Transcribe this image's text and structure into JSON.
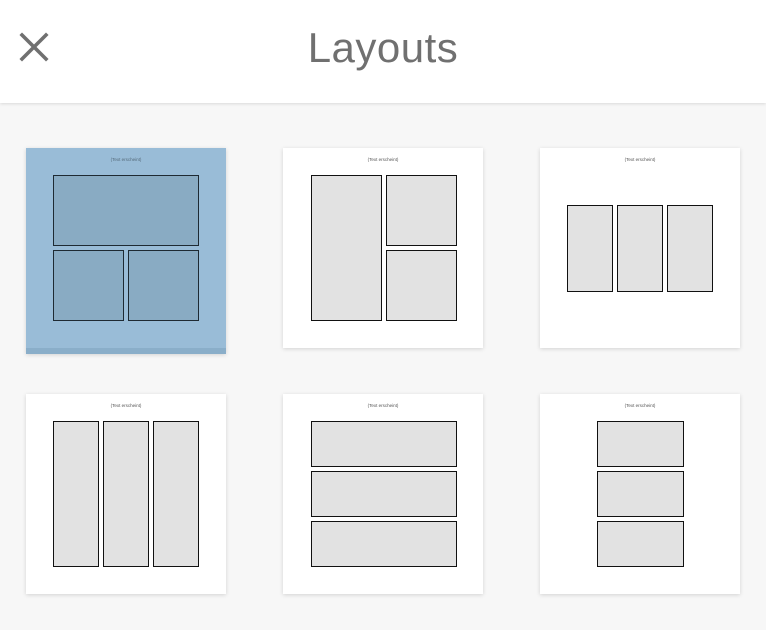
{
  "header": {
    "title": "Layouts",
    "close_icon": "close-icon"
  },
  "colors": {
    "selected_background": "#99bcd7",
    "frame_fill": "#e2e2e2",
    "title_text": "#707070"
  },
  "layouts": [
    {
      "name": "one-wide-top-two-bottom",
      "label": "(Text erscheint)",
      "selected": true
    },
    {
      "name": "tall-left-two-right",
      "label": "(Text erscheint)",
      "selected": false
    },
    {
      "name": "three-columns-short",
      "label": "(Text erscheint)",
      "selected": false
    },
    {
      "name": "three-columns-tall",
      "label": "(Text erscheint)",
      "selected": false
    },
    {
      "name": "three-rows-wide",
      "label": "(Text erscheint)",
      "selected": false
    },
    {
      "name": "three-rows-narrow",
      "label": "(Text erscheint)",
      "selected": false
    }
  ]
}
